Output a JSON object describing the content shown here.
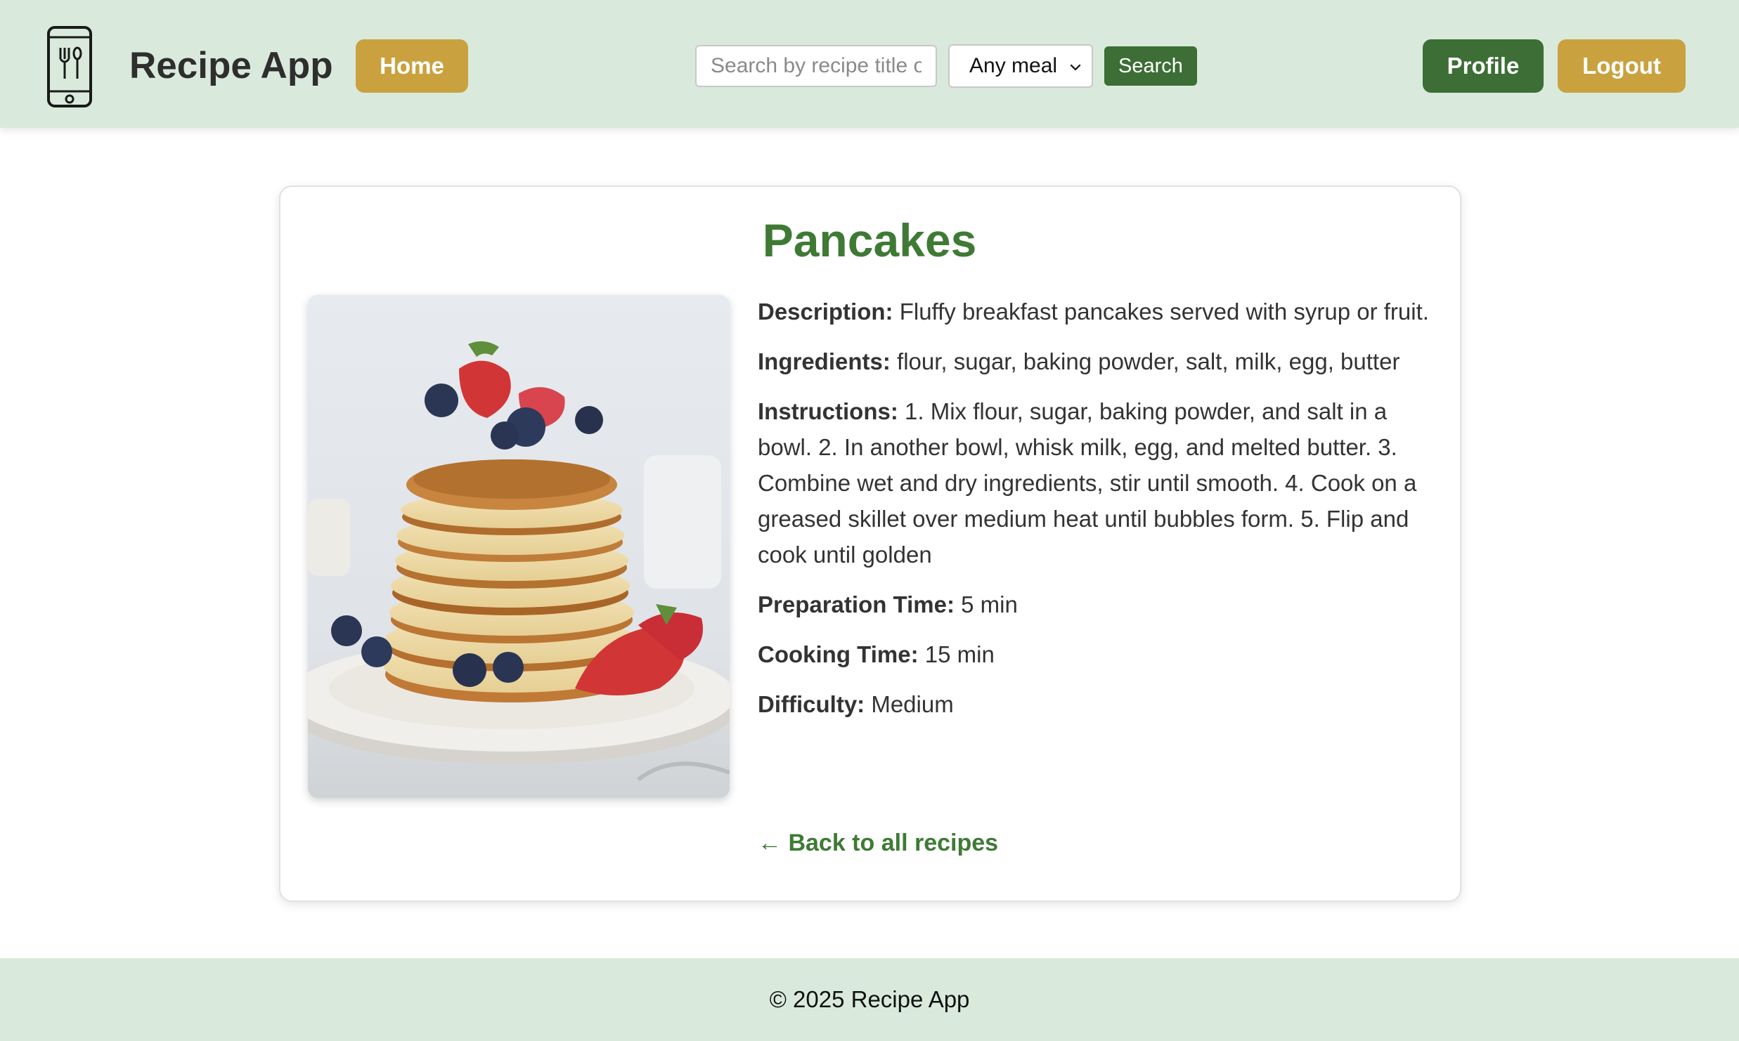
{
  "header": {
    "app_title": "Recipe App",
    "home_label": "Home",
    "search_placeholder": "Search by recipe title or",
    "meal_filter_selected": "Any meal",
    "search_label": "Search",
    "profile_label": "Profile",
    "logout_label": "Logout"
  },
  "recipe": {
    "title": "Pancakes",
    "image_subject": "stack of pancakes with strawberries and blueberries",
    "details": [
      {
        "label": "Description:",
        "value": "Fluffy breakfast pancakes served with syrup or fruit."
      },
      {
        "label": "Ingredients:",
        "value": "flour, sugar, baking powder, salt, milk, egg, butter"
      },
      {
        "label": "Instructions:",
        "value": "1. Mix flour, sugar, baking powder, and salt in a bowl. 2. In another bowl, whisk milk, egg, and melted butter. 3. Combine wet and dry ingredients, stir until smooth. 4. Cook on a greased skillet over medium heat until bubbles form. 5. Flip and cook until golden"
      },
      {
        "label": "Preparation Time:",
        "value": "5 min"
      },
      {
        "label": "Cooking Time:",
        "value": "15 min"
      },
      {
        "label": "Difficulty:",
        "value": "Medium"
      }
    ],
    "back_link": "← Back to all recipes"
  },
  "footer": {
    "copyright": "© 2025 Recipe App"
  },
  "colors": {
    "header_bg": "#d9eadc",
    "accent_green": "#3c6e35",
    "title_green": "#3f7a35",
    "accent_gold": "#c9a23f"
  },
  "icons": {
    "logo": "phone-utensils-icon",
    "select_arrow": "chevron-down-icon"
  }
}
